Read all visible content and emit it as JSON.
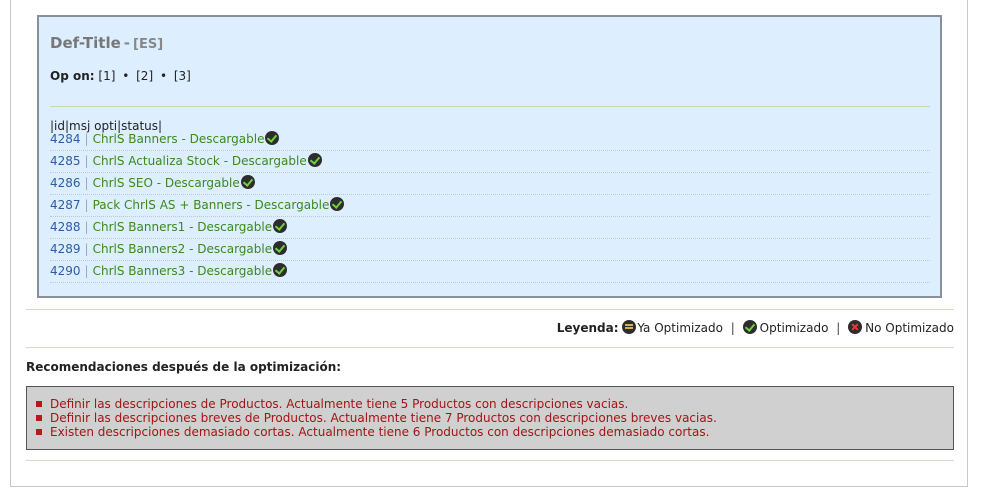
{
  "box": {
    "title": "Def-Title",
    "dash": "-",
    "lang": "[ES]",
    "op_label": "Op on:",
    "op_links": [
      "[1]",
      "[2]",
      "[3]"
    ],
    "op_sep": "•",
    "column_header": "|id|msj opti|status|",
    "rows": [
      {
        "id": "4284",
        "name": "ChrlS Banners - Descargable",
        "status_icon": "check-icon"
      },
      {
        "id": "4285",
        "name": "ChrlS Actualiza Stock - Descargable",
        "status_icon": "check-icon"
      },
      {
        "id": "4286",
        "name": "ChrlS SEO - Descargable",
        "status_icon": "check-icon"
      },
      {
        "id": "4287",
        "name": "Pack ChrlS AS + Banners - Descargable",
        "status_icon": "check-icon"
      },
      {
        "id": "4288",
        "name": "ChrlS Banners1 - Descargable",
        "status_icon": "check-icon"
      },
      {
        "id": "4289",
        "name": "ChrlS Banners2 - Descargable",
        "status_icon": "check-icon"
      },
      {
        "id": "4290",
        "name": "ChrlS Banners3 - Descargable",
        "status_icon": "check-icon"
      }
    ]
  },
  "legend": {
    "label": "Leyenda:",
    "ya_optimizado": "Ya Optimizado",
    "optimizado": "Optimizado",
    "no_optimizado": "No Optimizado",
    "divider": "|"
  },
  "recommendations": {
    "title": "Recomendaciones después de la optimización:",
    "items": [
      "Definir las descripciones de Productos. Actualmente tiene 5 Productos con descripciones vacias.",
      "Definir las descripciones breves de Productos. Actualmente tiene 7 Productos con descripciones breves vacias.",
      "Existen descripciones demasiado cortas. Actualmente tiene 6 Productos con descripciones demasiado cortas."
    ]
  },
  "colors": {
    "box_background": "#ddeeff",
    "id_link": "#2a5da8",
    "name_link": "#3a8a1e",
    "recommendation_text": "#a31414",
    "recommendation_box": "#d0d0d0"
  }
}
